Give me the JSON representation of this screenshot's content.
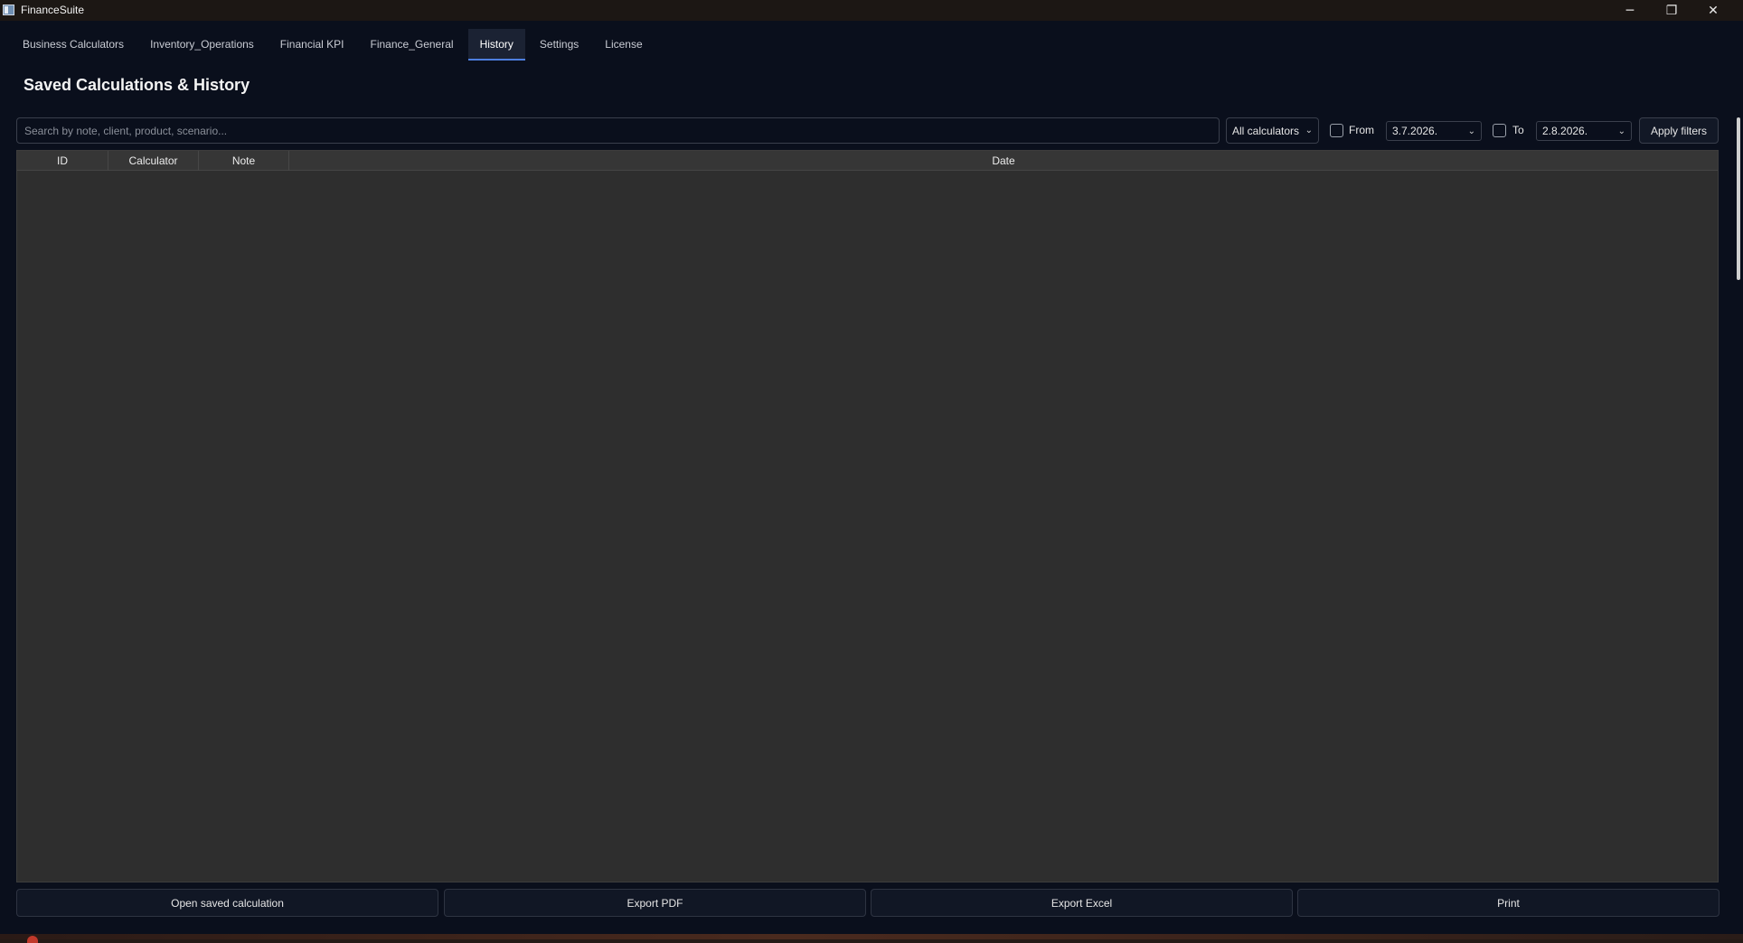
{
  "window": {
    "title": "FinanceSuite",
    "controls": {
      "minimize": "─",
      "maximize": "❐",
      "close": "✕"
    }
  },
  "tabs": [
    {
      "label": "Business Calculators",
      "active": false
    },
    {
      "label": "Inventory_Operations",
      "active": false
    },
    {
      "label": "Financial KPI",
      "active": false
    },
    {
      "label": "Finance_General",
      "active": false
    },
    {
      "label": "History",
      "active": true
    },
    {
      "label": "Settings",
      "active": false
    },
    {
      "label": "License",
      "active": false
    }
  ],
  "page": {
    "title": "Saved Calculations & History"
  },
  "filters": {
    "search_placeholder": "Search by note, client, product, scenario...",
    "search_value": "",
    "calculator_select": "All calculators",
    "from_label": "From",
    "from_checked": false,
    "from_date": "3.7.2026.",
    "to_label": "To",
    "to_checked": false,
    "to_date": "2.8.2026.",
    "apply_label": "Apply filters"
  },
  "table": {
    "columns": [
      "ID",
      "Calculator",
      "Note",
      "Date"
    ],
    "rows": []
  },
  "actions": {
    "open": "Open saved calculation",
    "export_pdf": "Export PDF",
    "export_excel": "Export Excel",
    "print": "Print"
  },
  "colors": {
    "background": "#0a0f1c",
    "accent": "#4e7fe0",
    "table_bg": "#2e2e2e"
  }
}
